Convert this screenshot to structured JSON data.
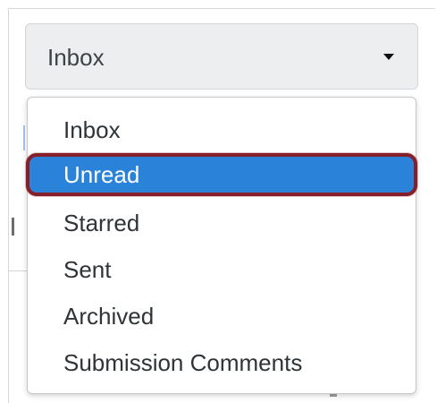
{
  "select": {
    "current_value": "Inbox",
    "caret_icon": "caret-down-icon"
  },
  "dropdown": {
    "options": [
      {
        "label": "Inbox"
      },
      {
        "label": "Unread",
        "highlighted": true
      },
      {
        "label": "Starred"
      },
      {
        "label": "Sent"
      },
      {
        "label": "Archived"
      },
      {
        "label": "Submission Comments"
      }
    ]
  },
  "colors": {
    "highlight_fill": "#2a83d9",
    "highlight_outline": "#861f2a",
    "select_background": "#eceeef"
  }
}
